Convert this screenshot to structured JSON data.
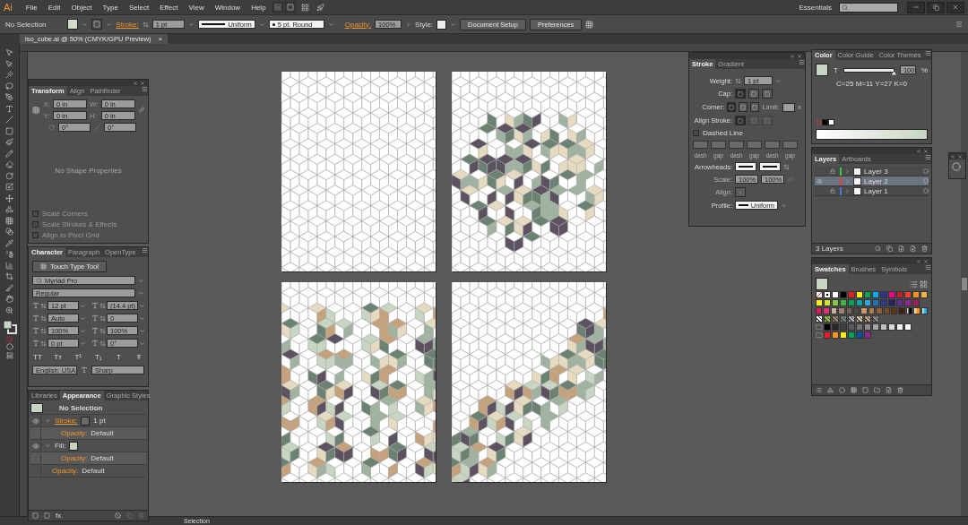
{
  "menu_bar": {
    "logo": "Ai",
    "items": [
      "File",
      "Edit",
      "Object",
      "Type",
      "Select",
      "Effect",
      "View",
      "Window",
      "Help"
    ],
    "workspace": "Essentials"
  },
  "control_bar": {
    "selection": "No Selection",
    "fill": {
      "color": "#d3dccb"
    },
    "stroke_label": "Stroke:",
    "stroke_weight": "1 pt",
    "profile": "Uniform",
    "brush": "5 pt. Round",
    "opacity_label": "Opacity:",
    "opacity": "100%",
    "style_label": "Style:",
    "buttons": [
      "Document Setup",
      "Preferences"
    ]
  },
  "document_tab": {
    "title": "iso_cube.ai @ 50% (CMYK/GPU Preview)",
    "close": "×"
  },
  "artboards": [
    {
      "kind": "plain"
    },
    {
      "kind": "scatter"
    },
    {
      "kind": "columns"
    },
    {
      "kind": "band"
    }
  ],
  "transform_panel": {
    "tabs": [
      {
        "label": "Transform",
        "selected": true
      },
      {
        "label": "Align",
        "selected": false
      },
      {
        "label": "Pathfinder",
        "selected": false
      }
    ],
    "fields": [
      {
        "label": "X:",
        "value": "0 in"
      },
      {
        "label": "W:",
        "value": "0 in"
      },
      {
        "label": "Y:",
        "value": "0 in"
      },
      {
        "label": "H:",
        "value": "0 in"
      }
    ],
    "angles": [
      "0°",
      "0°"
    ],
    "message": "No Shape Properties",
    "options": [
      {
        "label": "Scale Corners",
        "checked": false
      },
      {
        "label": "Scale Strokes & Effects",
        "checked": false
      },
      {
        "label": "Align to Pixel Grid",
        "checked": false
      }
    ]
  },
  "character_panel": {
    "tabs": [
      {
        "label": "Character",
        "selected": true
      },
      {
        "label": "Paragraph",
        "selected": false
      },
      {
        "label": "OpenType",
        "selected": false
      }
    ],
    "tool_button": "Touch Type Tool",
    "font": "Myriad Pro",
    "style": "Regular",
    "fields": [
      "12 pt",
      "(14.4 pt)",
      "Auto",
      "0",
      "100%",
      "100%",
      "0 pt",
      "0°"
    ],
    "type_buttons": [
      "TT",
      "Tт",
      "T¹",
      "T₁",
      "T",
      "Ŧ"
    ],
    "language": "English: USA",
    "antialiasing": "Sharp"
  },
  "appearance_panel": {
    "tabs": [
      {
        "label": "Libraries",
        "selected": false
      },
      {
        "label": "Appearance",
        "selected": true
      },
      {
        "label": "Graphic Styles",
        "selected": false
      }
    ],
    "header": "No Selection",
    "fx_label": "fx.",
    "rows": [
      {
        "kind": "stroke",
        "label": "Stroke:",
        "value": "1 pt",
        "visible": true
      },
      {
        "kind": "sub",
        "label": "Opacity:",
        "value": "Default",
        "visible": false
      },
      {
        "kind": "fill",
        "label": "Fill:",
        "visible": true
      },
      {
        "kind": "sub",
        "label": "Opacity:",
        "value": "Default",
        "visible": false
      },
      {
        "kind": "opacity",
        "label": "Opacity:",
        "value": "Default",
        "visible": false
      }
    ]
  },
  "stroke_panel": {
    "tabs": [
      {
        "label": "Stroke",
        "selected": true
      },
      {
        "label": "Gradient",
        "selected": false
      }
    ],
    "weight_label": "Weight:",
    "weight": "1 pt",
    "cap_label": "Cap:",
    "caps": [
      {
        "selected": true
      },
      {
        "selected": false
      },
      {
        "selected": false
      }
    ],
    "corner_label": "Corner:",
    "corners": [
      {
        "selected": true
      },
      {
        "selected": false
      },
      {
        "selected": false
      }
    ],
    "limit_label": "Limit:",
    "limit_unit": "x",
    "align_label": "Align Stroke:",
    "aligns": [
      {
        "selected": true,
        "disabled": false
      },
      {
        "selected": false,
        "disabled": true
      },
      {
        "selected": false,
        "disabled": true
      }
    ],
    "dashed": {
      "label": "Dashed Line",
      "checked": false
    },
    "dash_labels": [
      "dash",
      "gap",
      "dash",
      "gap",
      "dash",
      "gap"
    ],
    "arrowheads_label": "Arrowheads:",
    "scale_label": "Scale:",
    "scales": [
      "100%",
      "100%"
    ],
    "arrow_align_label": "Align:",
    "profile_label": "Profile:",
    "profile": "Uniform"
  },
  "color_panel": {
    "tabs": [
      {
        "label": "Color",
        "selected": true
      },
      {
        "label": "Color Guide",
        "selected": false
      },
      {
        "label": "Color Themes",
        "selected": false
      }
    ],
    "fill": {
      "color": "#c8d5c3"
    },
    "tint": {
      "label": "T",
      "level": 1,
      "value": "100"
    },
    "percent": "%",
    "readout": "C=25 M=11 Y=27 K=0"
  },
  "layers_panel": {
    "tabs": [
      {
        "label": "Layers",
        "selected": true
      },
      {
        "label": "Artboards",
        "selected": false
      }
    ],
    "layers": [
      {
        "name": "Layer 3",
        "color": "#3fc84a",
        "visible": false,
        "locked": true,
        "selected": false
      },
      {
        "name": "Layer 2",
        "color": "#e0413c",
        "visible": true,
        "locked": false,
        "selected": true
      },
      {
        "name": "Layer 1",
        "color": "#4a78d8",
        "visible": false,
        "locked": true,
        "selected": false
      }
    ],
    "count": "3 Layers"
  },
  "swatches_panel": {
    "tabs": [
      {
        "label": "Swatches",
        "selected": true
      },
      {
        "label": "Brushes",
        "selected": false
      },
      {
        "label": "Symbols",
        "selected": false
      }
    ],
    "fill": {
      "color": "#c8d5c3"
    },
    "rows": [
      {
        "folder": false,
        "items": [
          {
            "kind": "none"
          },
          {
            "kind": "registration"
          },
          {
            "color": "#ffffff"
          },
          {
            "color": "#000000"
          },
          {
            "color": "#ed1c24"
          },
          {
            "color": "#fff200"
          },
          {
            "color": "#00a651"
          },
          {
            "color": "#00aeef"
          },
          {
            "color": "#2e3192"
          },
          {
            "color": "#ec008c"
          },
          {
            "color": "#be1e2d"
          },
          {
            "color": "#ef4136"
          },
          {
            "color": "#f7941d"
          },
          {
            "color": "#fbb040"
          }
        ]
      },
      {
        "folder": false,
        "items": [
          {
            "color": "#fff200"
          },
          {
            "color": "#d7df23"
          },
          {
            "color": "#8dc63f"
          },
          {
            "color": "#39b54a"
          },
          {
            "color": "#00a651"
          },
          {
            "color": "#00a79d"
          },
          {
            "color": "#27aae1"
          },
          {
            "color": "#1c75bc"
          },
          {
            "color": "#2b3990"
          },
          {
            "color": "#262262"
          },
          {
            "color": "#662d91"
          },
          {
            "color": "#92278f"
          },
          {
            "color": "#9e1f63"
          }
        ]
      },
      {
        "folder": false,
        "items": [
          {
            "color": "#da1c5c"
          },
          {
            "color": "#ee2a7b"
          },
          {
            "color": "#c2b59b"
          },
          {
            "color": "#998675"
          },
          {
            "color": "#736357"
          },
          {
            "color": "#534741"
          },
          {
            "color": "#c69c6d"
          },
          {
            "color": "#a97c50"
          },
          {
            "color": "#8b5e3c"
          },
          {
            "color": "#754c29"
          },
          {
            "color": "#603913"
          },
          {
            "color": "#3c2415"
          },
          {
            "kind": "gradient",
            "color": "#000000"
          },
          {
            "kind": "gradient",
            "color": "#f7941d"
          },
          {
            "kind": "gradient",
            "color": "#27aae1"
          }
        ]
      },
      {
        "folder": false,
        "items": [
          {
            "kind": "pattern",
            "color": "#ffffff"
          },
          {
            "kind": "pattern",
            "color": "#8dc63f"
          },
          {
            "kind": "pattern",
            "color": "#a0826d"
          },
          {
            "kind": "pattern",
            "color": "#6d8a86"
          },
          {
            "kind": "pattern",
            "color": "#b0b0b0"
          },
          {
            "kind": "pattern",
            "color": "#d9c9a8"
          },
          {
            "kind": "pattern",
            "color": "#c8a882"
          },
          {
            "kind": "pattern",
            "color": "#8a8a8a"
          }
        ]
      },
      {
        "folder": true,
        "items": [
          {
            "color": "#000000"
          },
          {
            "color": "#262626"
          },
          {
            "color": "#404040"
          },
          {
            "color": "#595959"
          },
          {
            "color": "#737373"
          },
          {
            "color": "#8c8c8c"
          },
          {
            "color": "#a6a6a6"
          },
          {
            "color": "#bfbfbf"
          },
          {
            "color": "#d9d9d9"
          },
          {
            "color": "#f2f2f2"
          },
          {
            "color": "#ffffff"
          }
        ]
      },
      {
        "folder": true,
        "items": [
          {
            "color": "#ed1c24"
          },
          {
            "color": "#f7941d"
          },
          {
            "color": "#fff200"
          },
          {
            "color": "#00a651"
          },
          {
            "color": "#0054a6"
          },
          {
            "color": "#92278f"
          }
        ]
      }
    ]
  },
  "status_bar": {
    "tool": "Selection"
  }
}
